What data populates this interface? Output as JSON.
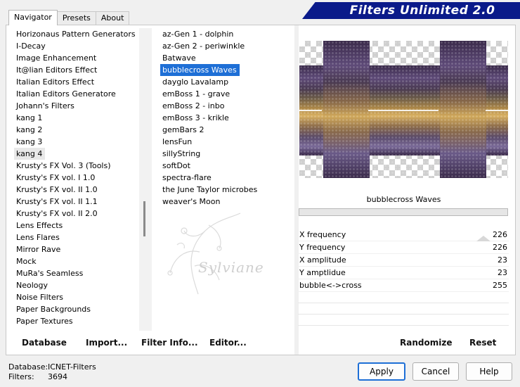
{
  "window": {
    "banner_title": "Filters Unlimited 2.0"
  },
  "tabs": [
    {
      "label": "Navigator",
      "active": true
    },
    {
      "label": "Presets",
      "active": false
    },
    {
      "label": "About",
      "active": false
    }
  ],
  "categories": [
    "Horizonaus Pattern Generators",
    "I-Decay",
    "Image Enhancement",
    "It@lian Editors Effect",
    "Italian Editors Effect",
    "Italian Editors Generatore",
    "Johann's Filters",
    "kang 1",
    "kang 2",
    "kang 3",
    "kang 4",
    "Krusty's FX Vol. 3 (Tools)",
    "Krusty's FX vol. I 1.0",
    "Krusty's FX vol. II 1.0",
    "Krusty's FX vol. II 1.1",
    "Krusty's FX vol. II 2.0",
    "Lens Effects",
    "Lens Flares",
    "Mirror Rave",
    "Mock",
    "MuRa's Seamless",
    "Neology",
    "Noise Filters",
    "Paper Backgrounds",
    "Paper Textures"
  ],
  "selected_category": "kang 4",
  "filters": [
    "az-Gen 1  -  dolphin",
    "az-Gen 2  -  periwinkle",
    "Batwave",
    "bubblecross Waves",
    "dayglo Lavalamp",
    "emBoss 1  -  grave",
    "emBoss 2  -  inbo",
    "emBoss 3  -  krikle",
    "gemBars 2",
    "lensFun",
    "sillyString",
    "softDot",
    "spectra-flare",
    "the June Taylor microbes",
    "weaver's Moon"
  ],
  "selected_filter": "bubblecross Waves",
  "filter_name": "bubblecross Waves",
  "parameters": [
    {
      "label": "X frequency",
      "value": "226"
    },
    {
      "label": "Y frequency",
      "value": "226"
    },
    {
      "label": "X amplitude",
      "value": "23"
    },
    {
      "label": "Y amptlidue",
      "value": "23"
    },
    {
      "label": "bubble<->cross",
      "value": "255"
    }
  ],
  "bottom_links": {
    "database": "Database",
    "import": "Import...",
    "filter_info": "Filter Info...",
    "editor": "Editor...",
    "randomize": "Randomize",
    "reset": "Reset"
  },
  "status": {
    "database_label": "Database:",
    "database_value": "ICNET-Filters",
    "filters_label": "Filters:",
    "filters_value": "3694"
  },
  "buttons": {
    "apply": "Apply",
    "cancel": "Cancel",
    "help": "Help"
  },
  "watermark_text": "Sylviane",
  "colors": {
    "banner": "#0a1a8a",
    "selection": "#1e6fd6"
  }
}
